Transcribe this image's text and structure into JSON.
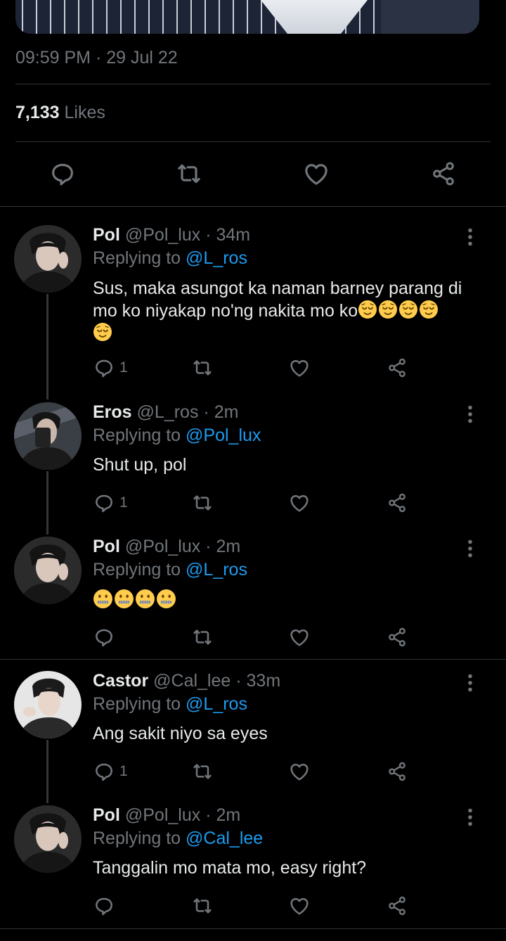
{
  "header": {
    "timestamp": "09:59 PM · 29 Jul 22"
  },
  "stats": {
    "likes_count": "7,133",
    "likes_label": "Likes"
  },
  "colors": {
    "accent": "#1d9bf0",
    "muted": "#71767b",
    "text": "#e7e9ea",
    "background": "#000000",
    "divider": "#2f3336"
  },
  "icons": {
    "reply": "comment-icon",
    "retweet": "retweet-icon",
    "like": "heart-icon",
    "share": "share-icon",
    "more": "more-vertical-icon"
  },
  "replies": [
    {
      "name": "Pol",
      "handle": "@Pol_lux",
      "sep": "·",
      "time": "34m",
      "replying_label": "Replying to",
      "mention": "@L_ros",
      "text": "Sus, maka asungot ka naman barney parang di mo ko niyakap no'ng nakita mo ko",
      "emoji": [
        "relieved-face",
        "relieved-face",
        "relieved-face",
        "relieved-face",
        "relieved-face"
      ],
      "reply_count": "1"
    },
    {
      "name": "Eros",
      "handle": "@L_ros",
      "sep": "·",
      "time": "2m",
      "replying_label": "Replying to",
      "mention": "@Pol_lux",
      "text": "Shut up, pol",
      "emoji": [],
      "reply_count": "1"
    },
    {
      "name": "Pol",
      "handle": "@Pol_lux",
      "sep": "·",
      "time": "2m",
      "replying_label": "Replying to",
      "mention": "@L_ros",
      "text": "",
      "emoji": [
        "zipper-mouth-face",
        "zipper-mouth-face",
        "zipper-mouth-face",
        "zipper-mouth-face"
      ],
      "reply_count": ""
    },
    {
      "name": "Castor",
      "handle": "@Cal_lee",
      "sep": "·",
      "time": "33m",
      "replying_label": "Replying to",
      "mention": "@L_ros",
      "text": "Ang sakit niyo sa eyes",
      "emoji": [],
      "reply_count": "1"
    },
    {
      "name": "Pol",
      "handle": "@Pol_lux",
      "sep": "·",
      "time": "2m",
      "replying_label": "Replying to",
      "mention": "@Cal_lee",
      "text": "Tanggalin mo mata mo, easy right?",
      "emoji": [],
      "reply_count": ""
    }
  ]
}
